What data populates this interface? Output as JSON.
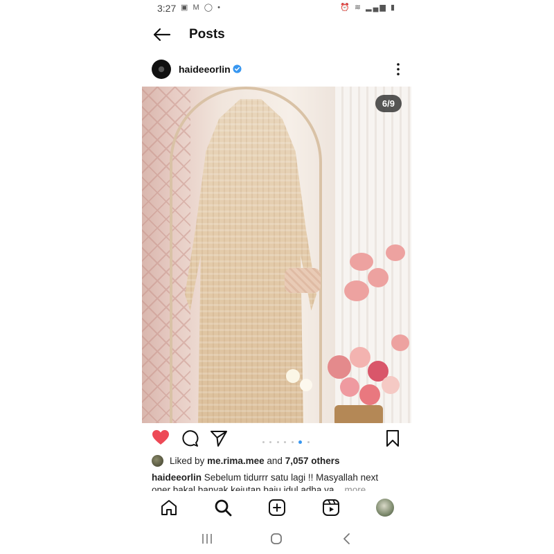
{
  "status_bar": {
    "time": "3:27",
    "left_icons": [
      "gallery-icon",
      "mail-icon",
      "whatsapp-icon",
      "dot-icon"
    ],
    "right_icons": [
      "alarm-icon",
      "wifi-icon",
      "signal-icon",
      "battery-icon"
    ]
  },
  "header": {
    "title": "Posts"
  },
  "post": {
    "username": "haideeorlin",
    "verified": true,
    "page_indicator": "6/9",
    "carousel": {
      "total": 9,
      "active": 6
    }
  },
  "likes": {
    "prefix": "Liked by",
    "user": "me.rima.mee",
    "joiner": "and",
    "others": "7,057 others"
  },
  "caption": {
    "username": "haideeorlin",
    "text_line1": "Sebelum tidurrr satu lagi !! Masyallah next",
    "text_line2": "oner bakal banyak kejutan baju idul adha ya...",
    "more": "more"
  },
  "bottom_nav": [
    "home-icon",
    "search-icon",
    "create-icon",
    "reels-icon",
    "profile-avatar"
  ],
  "colors": {
    "like_red": "#ed4956",
    "link_blue": "#3897f0",
    "verified_blue": "#3897f0"
  }
}
